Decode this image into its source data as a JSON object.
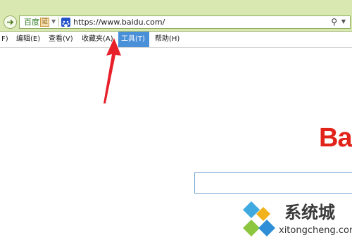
{
  "address_bar": {
    "site_name": "百度",
    "cert_label": "证",
    "url": "https://www.baidu.com/",
    "search_icon": "search-icon"
  },
  "menu": {
    "items": [
      {
        "label": "F)"
      },
      {
        "label": "编辑(E)"
      },
      {
        "label": "查看(V)"
      },
      {
        "label": "收藏夹(A)"
      },
      {
        "label": "工具(T)"
      },
      {
        "label": "帮助(H)"
      }
    ],
    "active_index": 4
  },
  "page": {
    "logo_text": "Ba",
    "logo_color": "#e2231a"
  },
  "watermark": {
    "title": "系统城",
    "url": "xitongcheng.com"
  },
  "annotation": {
    "arrow_color": "#e8202a"
  }
}
